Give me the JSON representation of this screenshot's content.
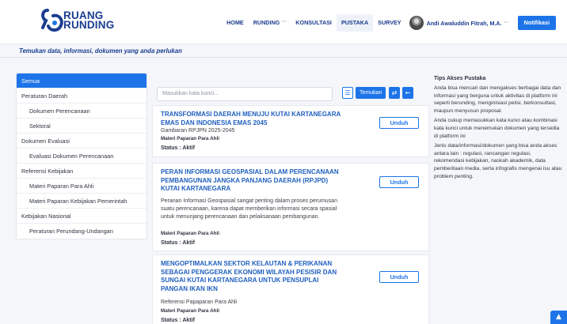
{
  "brand": {
    "line1": "RUANG",
    "line2": "RUNDING"
  },
  "nav": {
    "home": "HOME",
    "runding": "RUNDING",
    "konsultasi": "KONSULTASI",
    "pustaka": "PUSTAKA",
    "survey": "SURVEY",
    "user_name": "Andi Awaluddin Fitrah, M.A.",
    "notifikasi": "Notifikasi"
  },
  "tagline": "Temukan data, informasi, dokumen yang anda perlukan",
  "sidebar": {
    "items": [
      {
        "label": "Semua"
      },
      {
        "label": "Peraturan Daerah"
      },
      {
        "label": "Dokumen Perencanaan"
      },
      {
        "label": "Sektoral"
      },
      {
        "label": "Dokumen Evaluasi"
      },
      {
        "label": "Evaluasi Dokumen Perencanaan"
      },
      {
        "label": "Referensi Kebijakan"
      },
      {
        "label": "Materi Paparan Para Ahli"
      },
      {
        "label": "Materi Paparan Kebijakan Pemerintah"
      },
      {
        "label": "Kebijakan Nasional"
      },
      {
        "label": "Peraturan Perundang-Undangan"
      }
    ]
  },
  "search": {
    "placeholder": "Masukkan kata kunci...",
    "find_label": "Temukan"
  },
  "results": [
    {
      "title": "TRANSFORMASI DAERAH MENUJU KUTAI KARTANEGARA EMAS DAN INDONESIA EMAS 2045",
      "description": "Gambaran RPJPN 2025-2045",
      "category": "Materi Paparan Para Ahli",
      "status": "Status : Aktif",
      "download": "Unduh"
    },
    {
      "title": "PERAN INFORMASI GEOSPASIAL DALAM PERENCANAAN PEMBANGUNAN JANGKA PANJANG DAERAH (RPJPD) KUTAI KARTANEGARA",
      "description": "Peranan Informasi Geospasial sangat penting dalam proses perumusan suatu perencanaan, karena dapat memberikan informasi secara spasial untuk menunjang perencanaan dan pelaksanaan pembangunan.",
      "category": "Materi Paparan Para Ahli",
      "status": "Status : Aktif",
      "download": "Unduh"
    },
    {
      "title": "MENGOPTIMALKAN SEKTOR KELAUTAN & PERIKANAN SEBAGAI PENGGERAK EKONOMI WILAYAH PESISIR DAN SUNGAI KUTAI KARTANEGARA UNTUK PENSUPLAI PANGAN IKAN IKN",
      "description": "Referensi Papaparan Para Ahli",
      "category": "Materi Paparan Para Ahli",
      "status": "Status : Aktif",
      "download": "Unduh"
    }
  ],
  "tips": {
    "title": "Tips Akses Pustaka",
    "p1": "Anda bisa mencari dan mengakses berbagai data dan informasi yang berguna untuk aktivitas di platform ini seperti berunding, menginisiasi petisi, berkonsultasi, maupun menyusun proposal.",
    "p2": "Anda cukup memasukkan kata kunci atau kombinasi kata kunci untuk menemukan dokumen yang tersedia di platform ini",
    "p3": "Jenis data/informasi/dokumen yang bisa anda akses antara lain : regulasi, rancangan regulasi, rekomendasi kebijakan, naskah akademik, data pemberitaan media, serta infografis mengenai isu atau problem penting."
  },
  "colors": {
    "primary": "#1d74e8",
    "title_blue": "#1f5fbf",
    "brand_navy": "#1a3d8f"
  }
}
